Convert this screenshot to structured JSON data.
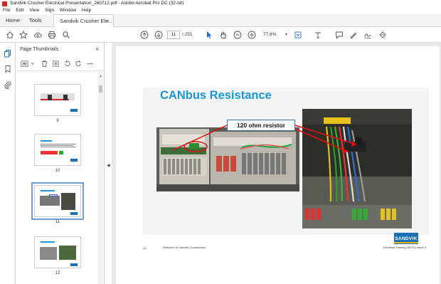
{
  "titlebar": {
    "text": "Sandvik Crusher Electrical Presentation_260712.pdf - Adobe Acrobat Pro DC (32-bit)"
  },
  "menubar": {
    "items": [
      "File",
      "Edit",
      "View",
      "Sign",
      "Window",
      "Help"
    ]
  },
  "tabs": {
    "home": "Home",
    "tools": "Tools",
    "document": "Sandvik Crusher Ele...",
    "close": "×"
  },
  "toolbar": {
    "page_current": "11",
    "page_total": "/ 251",
    "zoom": "77.6%",
    "zoom_arrow": "▾"
  },
  "panel": {
    "title": "Page Thumbnails",
    "close": "×",
    "thumbnails": [
      {
        "number": "9",
        "selected": false
      },
      {
        "number": "10",
        "selected": false
      },
      {
        "number": "11",
        "selected": true
      },
      {
        "number": "12",
        "selected": false
      }
    ]
  },
  "slide": {
    "title": "CANbus Resistance",
    "callout": "120 ohm resistor",
    "footer_page": "11",
    "footer_left": "Welcome to Sandvik Construction",
    "footer_right": "Electrical Training 260712 Issue 0",
    "logo": "SANDVIK"
  },
  "colors": {
    "title_blue": "#1a98d5",
    "logo_blue": "#1a6fb5",
    "arrow_red": "#e01010",
    "selection_blue": "#6d9dd8"
  },
  "icons": [
    "home-icon",
    "star-icon",
    "upload-icon",
    "print-icon",
    "search-icon",
    "prev-page-icon",
    "next-page-icon",
    "select-cursor-icon",
    "hand-icon",
    "zoom-out-icon",
    "zoom-in-icon",
    "fit-page-icon",
    "comment-icon",
    "highlight-icon",
    "sign-icon",
    "share-icon"
  ]
}
